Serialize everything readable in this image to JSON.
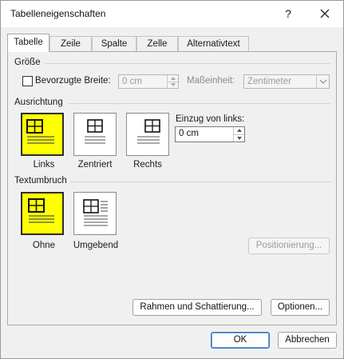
{
  "window": {
    "title": "Tabelleneigenschaften",
    "help_label": "?"
  },
  "tabs": [
    {
      "label": "Tabelle",
      "active": true
    },
    {
      "label": "Zeile",
      "active": false
    },
    {
      "label": "Spalte",
      "active": false
    },
    {
      "label": "Zelle",
      "active": false
    },
    {
      "label": "Alternativtext",
      "active": false
    }
  ],
  "size_section": {
    "heading": "Größe",
    "preferred_width_label": "Bevorzugte Breite:",
    "preferred_width_checked": false,
    "preferred_width_value": "0 cm",
    "unit_label": "Maßeinheit:",
    "unit_value": "Zentimeter"
  },
  "alignment_section": {
    "heading": "Ausrichtung",
    "options": [
      {
        "label": "Links",
        "icon": "table-align-left-icon",
        "selected": true
      },
      {
        "label": "Zentriert",
        "icon": "table-align-center-icon",
        "selected": false
      },
      {
        "label": "Rechts",
        "icon": "table-align-right-icon",
        "selected": false
      }
    ],
    "indent_label": "Einzug von links:",
    "indent_value": "0 cm"
  },
  "wrap_section": {
    "heading": "Textumbruch",
    "options": [
      {
        "label": "Ohne",
        "icon": "text-wrap-none-icon",
        "selected": true
      },
      {
        "label": "Umgebend",
        "icon": "text-wrap-around-icon",
        "selected": false
      }
    ],
    "positioning_button": "Positionierung..."
  },
  "panel_buttons": {
    "borders": "Rahmen und Schattierung...",
    "options": "Optionen..."
  },
  "footer": {
    "ok": "OK",
    "cancel": "Abbrechen"
  },
  "colors": {
    "selected_fill": "#ffff00",
    "default_button_border": "#3a76c9"
  }
}
